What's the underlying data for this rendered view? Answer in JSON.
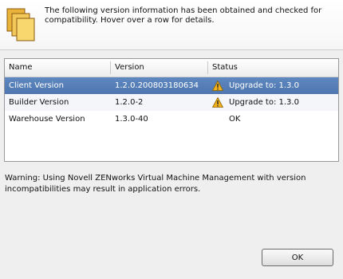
{
  "header": {
    "message": "The following version information has been obtained and checked for compatibility.  Hover over a row for details.",
    "icon": "documents-icon"
  },
  "table": {
    "columns": [
      "Name",
      "Version",
      "Status"
    ],
    "rows": [
      {
        "name": "Client Version",
        "version": "1.2.0.200803180634",
        "status": "Upgrade to: 1.3.0",
        "icon": "warning-icon",
        "selected": true
      },
      {
        "name": "Builder Version",
        "version": "1.2.0-2",
        "status": "Upgrade to: 1.3.0",
        "icon": "warning-icon",
        "selected": false
      },
      {
        "name": "Warehouse Version",
        "version": "1.3.0-40",
        "status": "OK",
        "icon": "",
        "selected": false
      }
    ]
  },
  "warning_text": "Warning: Using Novell ZENworks Virtual Machine Management with version incompatibilities may result in application errors.",
  "buttons": {
    "ok": "OK"
  },
  "colors": {
    "selected_row": "#5a82bb",
    "warning_icon": "#f2b21b"
  }
}
